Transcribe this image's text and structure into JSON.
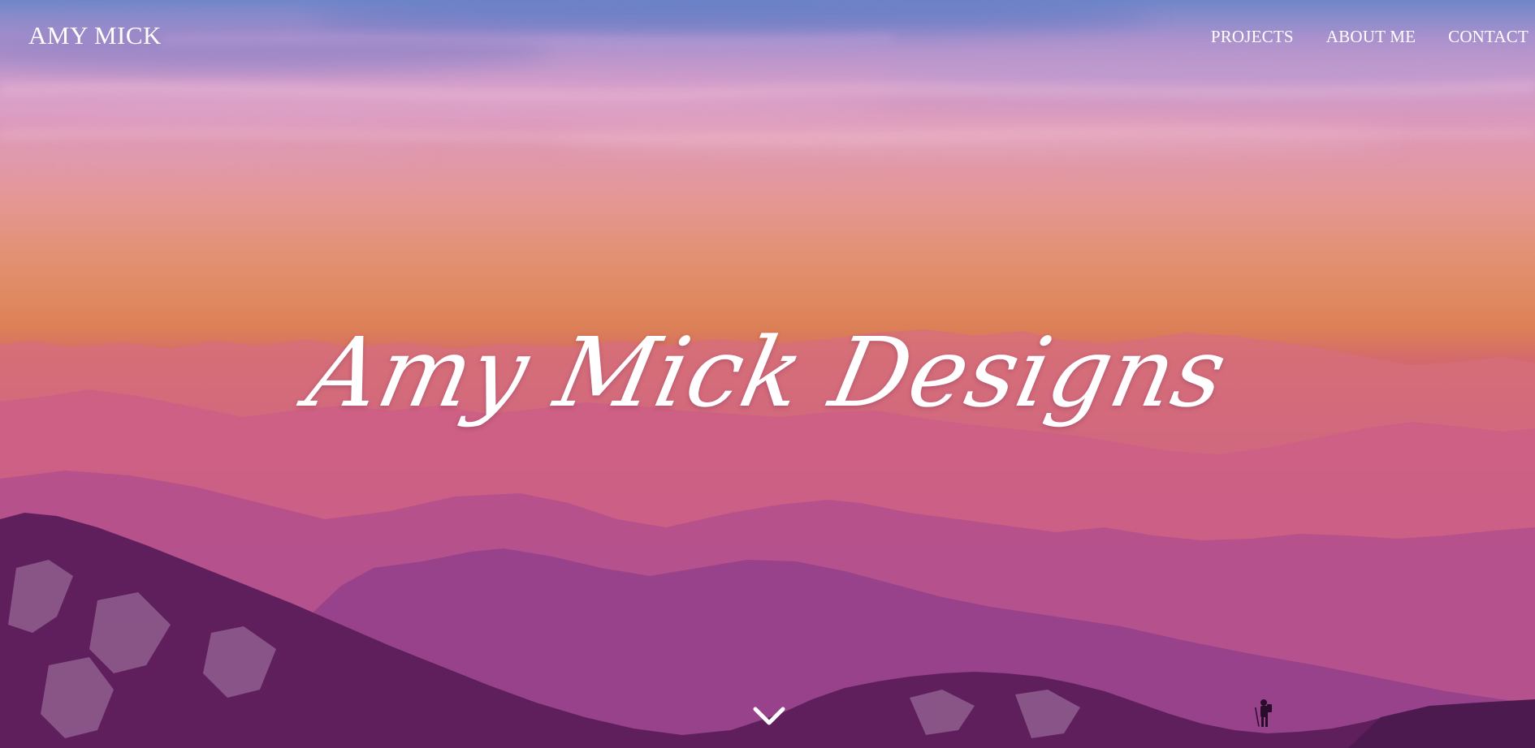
{
  "brand": {
    "name": "AMY MICK"
  },
  "nav": {
    "items": [
      {
        "label": "PROJECTS"
      },
      {
        "label": "ABOUT ME"
      },
      {
        "label": "CONTACT"
      }
    ]
  },
  "hero": {
    "headline": "Amy Mick Designs",
    "scroll_icon": "chevron-down-icon",
    "colors": {
      "sky_top": "#6f86c9",
      "sky_orange": "#e08960",
      "mountain_pink": "#c85a7c",
      "mountain_purple": "#7c2f73",
      "text": "#ffffff"
    }
  }
}
